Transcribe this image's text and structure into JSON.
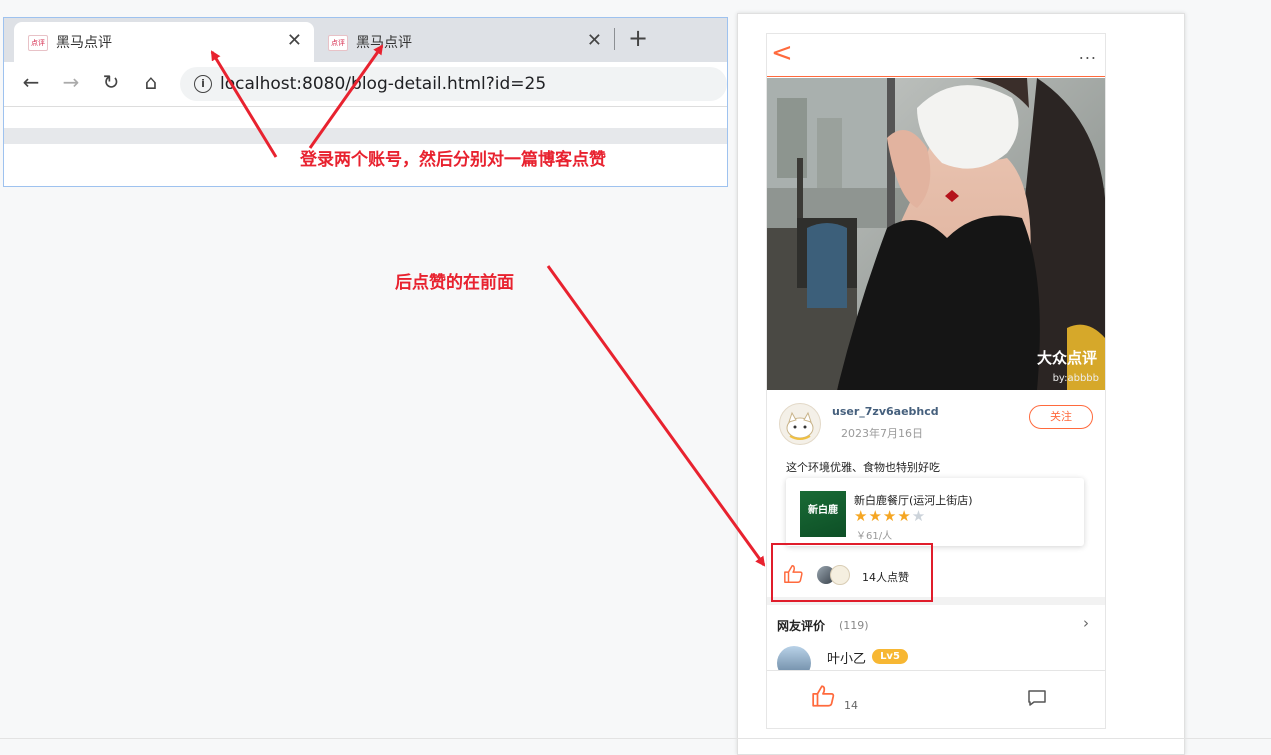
{
  "browser": {
    "tabs": [
      {
        "title": "黑马点评",
        "favicon": "点评",
        "close": "✕",
        "active": true
      },
      {
        "title": "黑马点评",
        "favicon": "点评",
        "close": "✕",
        "active": false
      }
    ],
    "new_tab": "+",
    "url": "localhost:8080/blog-detail.html?id=25",
    "info_icon": "i"
  },
  "phone": {
    "header": {
      "back": "<",
      "more": "..."
    },
    "watermark": {
      "brand": "大众点评",
      "user": "by:abbbb"
    },
    "author": {
      "name": "user_7zv6aebhcd",
      "date": "2023年7月16日"
    },
    "follow_label": "关注",
    "content": "这个环境优雅、食物也特别好吃",
    "shop": {
      "name": "新白鹿餐厅(运河上街店)",
      "image_text": "新白鹿",
      "rating": 4,
      "rating_max": 5,
      "price": "￥61/人"
    },
    "likes_text": "14人点赞",
    "comments": {
      "title": "网友评价",
      "count": "(119)",
      "first_user": "叶小乙",
      "first_level": "Lv5"
    },
    "bottom": {
      "like_count": "14"
    }
  },
  "annotations": {
    "note1": "登录两个账号，然后分别对一篇博客点赞",
    "note2": "后点赞的在前面"
  },
  "colors": {
    "accent": "#ff6a3d",
    "annotation": "#e8222f",
    "star": "#f5a623"
  }
}
